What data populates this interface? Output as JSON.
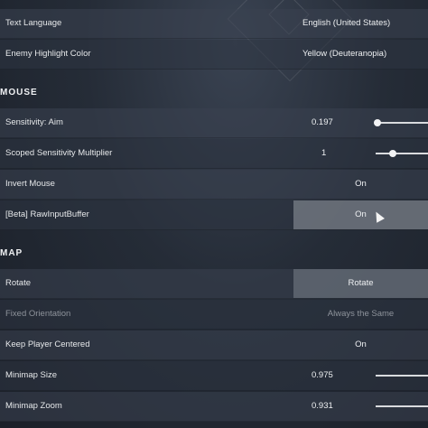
{
  "general": {
    "text_language_label": "Text Language",
    "text_language_value": "English (United States)",
    "enemy_highlight_label": "Enemy Highlight Color",
    "enemy_highlight_value": "Yellow (Deuteranopia)"
  },
  "mouse": {
    "section_title": "MOUSE",
    "sensitivity_aim_label": "Sensitivity: Aim",
    "sensitivity_aim_value": "0.197",
    "sensitivity_aim_fraction": 0.02,
    "scoped_multiplier_label": "Scoped Sensitivity Multiplier",
    "scoped_multiplier_value": "1",
    "scoped_multiplier_fraction": 0.2,
    "invert_mouse_label": "Invert Mouse",
    "invert_mouse_value": "On",
    "raw_input_label": "[Beta] RawInputBuffer",
    "raw_input_value": "On"
  },
  "map": {
    "section_title": "MAP",
    "rotate_label": "Rotate",
    "rotate_value": "Rotate",
    "fixed_orientation_label": "Fixed Orientation",
    "fixed_orientation_value": "Always the Same",
    "keep_centered_label": "Keep Player Centered",
    "keep_centered_value": "On",
    "minimap_size_label": "Minimap Size",
    "minimap_size_value": "0.975",
    "minimap_zoom_label": "Minimap Zoom",
    "minimap_zoom_value": "0.931"
  },
  "colors": {
    "row_bg": "#3a4250",
    "hover_bg": "#787e88",
    "text": "#e9eaec",
    "disabled_text": "#8e939b"
  }
}
